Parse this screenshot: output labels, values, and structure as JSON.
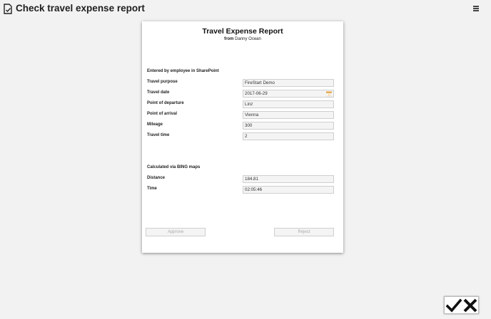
{
  "header": {
    "title": "Check travel expense report",
    "title_icon": "document-check-icon",
    "menu_icon": "hamburger-menu-icon"
  },
  "report": {
    "title": "Travel Expense Report",
    "from_label": "from",
    "from_name": "Danny Ocean",
    "section_employee": "Entered by employee in SharePoint",
    "fields": [
      {
        "label": "Travel purpose",
        "value": "FireStart Demo"
      },
      {
        "label": "Travel date",
        "value": "2017-06-29"
      },
      {
        "label": "Point of departure",
        "value": "Linz"
      },
      {
        "label": "Point of arrival",
        "value": "Vienna"
      },
      {
        "label": "Mileage",
        "value": "300"
      },
      {
        "label": "Travel time",
        "value": "2"
      }
    ],
    "section_bing": "Calculated via BING maps",
    "bing_fields": [
      {
        "label": "Distance",
        "value": "184.81"
      },
      {
        "label": "Time",
        "value": "02:05:46"
      }
    ],
    "calendar_icon": "calendar-icon",
    "approve_label": "Approve",
    "reject_label": "Reject"
  },
  "corner": {
    "approve_icon": "checkmark-icon",
    "reject_icon": "x-icon"
  }
}
